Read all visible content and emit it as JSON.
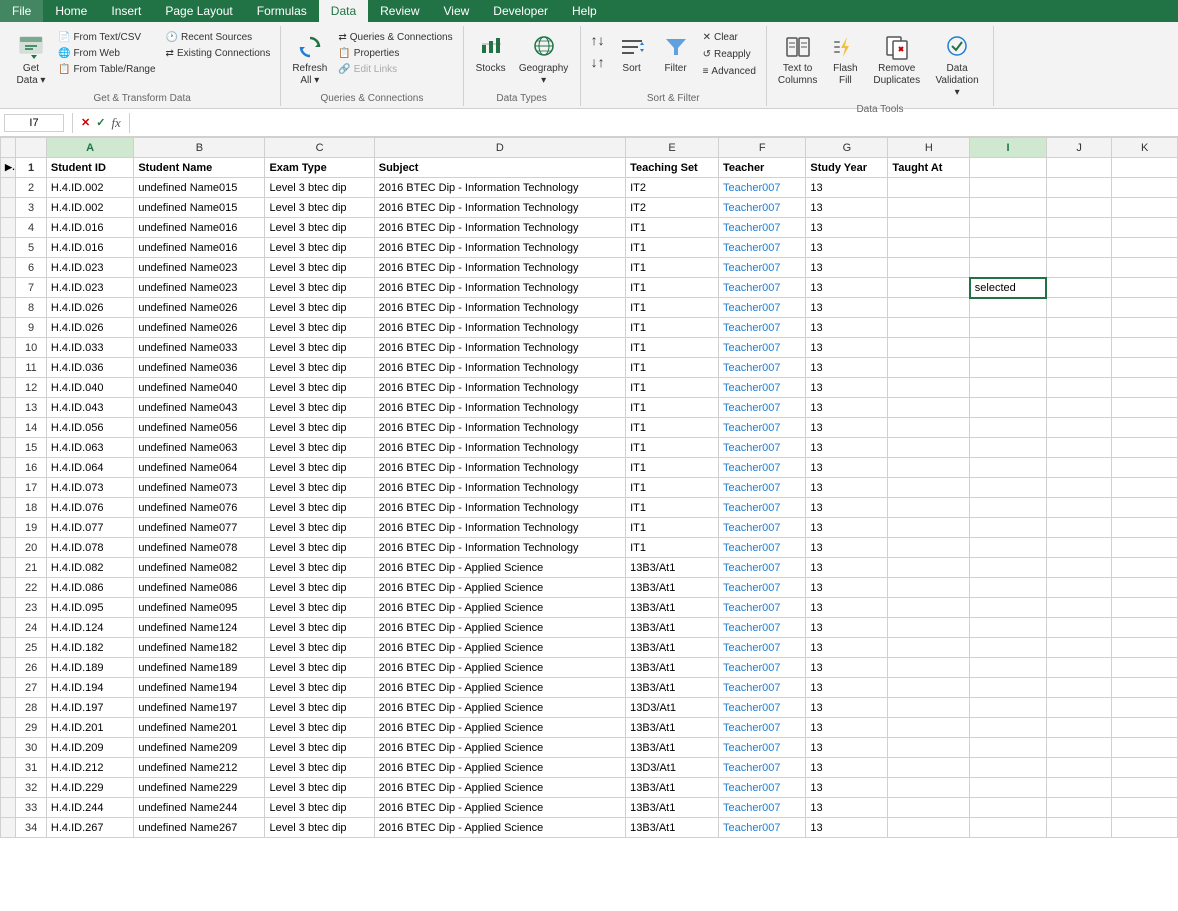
{
  "menubar": {
    "items": [
      "File",
      "Home",
      "Insert",
      "Page Layout",
      "Formulas",
      "Data",
      "Review",
      "View",
      "Developer",
      "Help"
    ]
  },
  "ribbon": {
    "active_tab": "Data",
    "groups": {
      "get_transform": {
        "label": "Get & Transform Data",
        "buttons": [
          {
            "id": "get-data",
            "icon": "📥",
            "label": "Get\nData",
            "dropdown": true
          },
          {
            "id": "from-text-csv",
            "icon": "📄",
            "label": "From\nText/CSV"
          },
          {
            "id": "from-web",
            "icon": "🌐",
            "label": "From\nWeb"
          },
          {
            "id": "from-table-range",
            "icon": "📋",
            "label": "From\nTable/\nRange"
          },
          {
            "id": "recent-sources",
            "icon": "🕐",
            "label": "Recent\nSources"
          },
          {
            "id": "existing-connections",
            "icon": "🔗",
            "label": "Existing\nConnections"
          }
        ]
      },
      "queries_connections": {
        "label": "Queries & Connections",
        "buttons_small": [
          {
            "id": "queries-connections",
            "icon": "⇄",
            "label": "Queries & Connections"
          },
          {
            "id": "properties",
            "icon": "📋",
            "label": "Properties"
          },
          {
            "id": "edit-links",
            "icon": "🔗",
            "label": "Edit Links"
          }
        ],
        "buttons_main": [
          {
            "id": "refresh-all",
            "icon": "🔄",
            "label": "Refresh\nAll",
            "dropdown": true
          }
        ]
      },
      "data_types": {
        "label": "Data Types",
        "buttons": [
          {
            "id": "stocks",
            "icon": "📈",
            "label": "Stocks"
          },
          {
            "id": "geography",
            "icon": "🌍",
            "label": "Geography",
            "dropdown": true
          }
        ]
      },
      "sort_filter": {
        "label": "Sort & Filter",
        "buttons": [
          {
            "id": "sort-asc",
            "icon": "↑",
            "label": ""
          },
          {
            "id": "sort-desc",
            "icon": "↓",
            "label": ""
          },
          {
            "id": "sort",
            "icon": "↕",
            "label": "Sort"
          },
          {
            "id": "filter",
            "icon": "▼",
            "label": "Filter"
          },
          {
            "id": "clear",
            "icon": "✕",
            "label": "Clear"
          },
          {
            "id": "reapply",
            "icon": "↺",
            "label": "Reapply"
          },
          {
            "id": "advanced",
            "icon": "≡",
            "label": "Advanced"
          }
        ]
      },
      "data_tools": {
        "label": "Data Tools",
        "buttons": [
          {
            "id": "text-to-columns",
            "icon": "⟺",
            "label": "Text to\nColumns"
          },
          {
            "id": "flash-fill",
            "icon": "⚡",
            "label": "Flash\nFill"
          },
          {
            "id": "remove-duplicates",
            "icon": "🗑",
            "label": "Remove\nDuplicates"
          },
          {
            "id": "data-validation",
            "icon": "✓",
            "label": "Data\nValidation",
            "dropdown": true
          }
        ]
      }
    }
  },
  "formula_bar": {
    "cell_ref": "I7",
    "formula": ""
  },
  "spreadsheet": {
    "columns": [
      "",
      "",
      "A",
      "B",
      "C",
      "D",
      "E",
      "F",
      "G",
      "H",
      "I",
      "J",
      "K"
    ],
    "col_letters": [
      "A",
      "B",
      "C",
      "D",
      "E",
      "F",
      "G",
      "H",
      "I",
      "J",
      "K"
    ],
    "headers": [
      "Student ID",
      "Student Name",
      "Exam Type",
      "Subject",
      "Teaching Set",
      "Teacher",
      "Study Year",
      "Taught At",
      "",
      "",
      ""
    ],
    "rows": [
      {
        "num": 2,
        "a": "H.4.ID.002",
        "b": "undefined Name015",
        "c": "Level 3 btec dip",
        "d": "2016 BTEC Dip - Information Technology",
        "e": "IT2",
        "f": "Teacher007",
        "g": "13",
        "h": "",
        "i": "",
        "j": "",
        "k": ""
      },
      {
        "num": 3,
        "a": "H.4.ID.002",
        "b": "undefined Name015",
        "c": "Level 3 btec dip",
        "d": "2016 BTEC Dip - Information Technology",
        "e": "IT2",
        "f": "Teacher007",
        "g": "13",
        "h": "",
        "i": "",
        "j": "",
        "k": ""
      },
      {
        "num": 4,
        "a": "H.4.ID.016",
        "b": "undefined Name016",
        "c": "Level 3 btec dip",
        "d": "2016 BTEC Dip - Information Technology",
        "e": "IT1",
        "f": "Teacher007",
        "g": "13",
        "h": "",
        "i": "",
        "j": "",
        "k": ""
      },
      {
        "num": 5,
        "a": "H.4.ID.016",
        "b": "undefined Name016",
        "c": "Level 3 btec dip",
        "d": "2016 BTEC Dip - Information Technology",
        "e": "IT1",
        "f": "Teacher007",
        "g": "13",
        "h": "",
        "i": "",
        "j": "",
        "k": ""
      },
      {
        "num": 6,
        "a": "H.4.ID.023",
        "b": "undefined Name023",
        "c": "Level 3 btec dip",
        "d": "2016 BTEC Dip - Information Technology",
        "e": "IT1",
        "f": "Teacher007",
        "g": "13",
        "h": "",
        "i": "",
        "j": "",
        "k": ""
      },
      {
        "num": 7,
        "a": "H.4.ID.023",
        "b": "undefined Name023",
        "c": "Level 3 btec dip",
        "d": "2016 BTEC Dip - Information Technology",
        "e": "IT1",
        "f": "Teacher007",
        "g": "13",
        "h": "",
        "i": "selected",
        "j": "",
        "k": ""
      },
      {
        "num": 8,
        "a": "H.4.ID.026",
        "b": "undefined Name026",
        "c": "Level 3 btec dip",
        "d": "2016 BTEC Dip - Information Technology",
        "e": "IT1",
        "f": "Teacher007",
        "g": "13",
        "h": "",
        "i": "",
        "j": "",
        "k": ""
      },
      {
        "num": 9,
        "a": "H.4.ID.026",
        "b": "undefined Name026",
        "c": "Level 3 btec dip",
        "d": "2016 BTEC Dip - Information Technology",
        "e": "IT1",
        "f": "Teacher007",
        "g": "13",
        "h": "",
        "i": "",
        "j": "",
        "k": ""
      },
      {
        "num": 10,
        "a": "H.4.ID.033",
        "b": "undefined Name033",
        "c": "Level 3 btec dip",
        "d": "2016 BTEC Dip - Information Technology",
        "e": "IT1",
        "f": "Teacher007",
        "g": "13",
        "h": "",
        "i": "",
        "j": "",
        "k": ""
      },
      {
        "num": 11,
        "a": "H.4.ID.036",
        "b": "undefined Name036",
        "c": "Level 3 btec dip",
        "d": "2016 BTEC Dip - Information Technology",
        "e": "IT1",
        "f": "Teacher007",
        "g": "13",
        "h": "",
        "i": "",
        "j": "",
        "k": ""
      },
      {
        "num": 12,
        "a": "H.4.ID.040",
        "b": "undefined Name040",
        "c": "Level 3 btec dip",
        "d": "2016 BTEC Dip - Information Technology",
        "e": "IT1",
        "f": "Teacher007",
        "g": "13",
        "h": "",
        "i": "",
        "j": "",
        "k": ""
      },
      {
        "num": 13,
        "a": "H.4.ID.043",
        "b": "undefined Name043",
        "c": "Level 3 btec dip",
        "d": "2016 BTEC Dip - Information Technology",
        "e": "IT1",
        "f": "Teacher007",
        "g": "13",
        "h": "",
        "i": "",
        "j": "",
        "k": ""
      },
      {
        "num": 14,
        "a": "H.4.ID.056",
        "b": "undefined Name056",
        "c": "Level 3 btec dip",
        "d": "2016 BTEC Dip - Information Technology",
        "e": "IT1",
        "f": "Teacher007",
        "g": "13",
        "h": "",
        "i": "",
        "j": "",
        "k": ""
      },
      {
        "num": 15,
        "a": "H.4.ID.063",
        "b": "undefined Name063",
        "c": "Level 3 btec dip",
        "d": "2016 BTEC Dip - Information Technology",
        "e": "IT1",
        "f": "Teacher007",
        "g": "13",
        "h": "",
        "i": "",
        "j": "",
        "k": ""
      },
      {
        "num": 16,
        "a": "H.4.ID.064",
        "b": "undefined Name064",
        "c": "Level 3 btec dip",
        "d": "2016 BTEC Dip - Information Technology",
        "e": "IT1",
        "f": "Teacher007",
        "g": "13",
        "h": "",
        "i": "",
        "j": "",
        "k": ""
      },
      {
        "num": 17,
        "a": "H.4.ID.073",
        "b": "undefined Name073",
        "c": "Level 3 btec dip",
        "d": "2016 BTEC Dip - Information Technology",
        "e": "IT1",
        "f": "Teacher007",
        "g": "13",
        "h": "",
        "i": "",
        "j": "",
        "k": ""
      },
      {
        "num": 18,
        "a": "H.4.ID.076",
        "b": "undefined Name076",
        "c": "Level 3 btec dip",
        "d": "2016 BTEC Dip - Information Technology",
        "e": "IT1",
        "f": "Teacher007",
        "g": "13",
        "h": "",
        "i": "",
        "j": "",
        "k": ""
      },
      {
        "num": 19,
        "a": "H.4.ID.077",
        "b": "undefined Name077",
        "c": "Level 3 btec dip",
        "d": "2016 BTEC Dip - Information Technology",
        "e": "IT1",
        "f": "Teacher007",
        "g": "13",
        "h": "",
        "i": "",
        "j": "",
        "k": ""
      },
      {
        "num": 20,
        "a": "H.4.ID.078",
        "b": "undefined Name078",
        "c": "Level 3 btec dip",
        "d": "2016 BTEC Dip - Information Technology",
        "e": "IT1",
        "f": "Teacher007",
        "g": "13",
        "h": "",
        "i": "",
        "j": "",
        "k": ""
      },
      {
        "num": 21,
        "a": "H.4.ID.082",
        "b": "undefined Name082",
        "c": "Level 3 btec dip",
        "d": "2016 BTEC Dip - Applied Science",
        "e": "13B3/At1",
        "f": "Teacher007",
        "g": "13",
        "h": "",
        "i": "",
        "j": "",
        "k": ""
      },
      {
        "num": 22,
        "a": "H.4.ID.086",
        "b": "undefined Name086",
        "c": "Level 3 btec dip",
        "d": "2016 BTEC Dip - Applied Science",
        "e": "13B3/At1",
        "f": "Teacher007",
        "g": "13",
        "h": "",
        "i": "",
        "j": "",
        "k": ""
      },
      {
        "num": 23,
        "a": "H.4.ID.095",
        "b": "undefined Name095",
        "c": "Level 3 btec dip",
        "d": "2016 BTEC Dip - Applied Science",
        "e": "13B3/At1",
        "f": "Teacher007",
        "g": "13",
        "h": "",
        "i": "",
        "j": "",
        "k": ""
      },
      {
        "num": 24,
        "a": "H.4.ID.124",
        "b": "undefined Name124",
        "c": "Level 3 btec dip",
        "d": "2016 BTEC Dip - Applied Science",
        "e": "13B3/At1",
        "f": "Teacher007",
        "g": "13",
        "h": "",
        "i": "",
        "j": "",
        "k": ""
      },
      {
        "num": 25,
        "a": "H.4.ID.182",
        "b": "undefined Name182",
        "c": "Level 3 btec dip",
        "d": "2016 BTEC Dip - Applied Science",
        "e": "13B3/At1",
        "f": "Teacher007",
        "g": "13",
        "h": "",
        "i": "",
        "j": "",
        "k": ""
      },
      {
        "num": 26,
        "a": "H.4.ID.189",
        "b": "undefined Name189",
        "c": "Level 3 btec dip",
        "d": "2016 BTEC Dip - Applied Science",
        "e": "13B3/At1",
        "f": "Teacher007",
        "g": "13",
        "h": "",
        "i": "",
        "j": "",
        "k": ""
      },
      {
        "num": 27,
        "a": "H.4.ID.194",
        "b": "undefined Name194",
        "c": "Level 3 btec dip",
        "d": "2016 BTEC Dip - Applied Science",
        "e": "13B3/At1",
        "f": "Teacher007",
        "g": "13",
        "h": "",
        "i": "",
        "j": "",
        "k": ""
      },
      {
        "num": 28,
        "a": "H.4.ID.197",
        "b": "undefined Name197",
        "c": "Level 3 btec dip",
        "d": "2016 BTEC Dip - Applied Science",
        "e": "13D3/At1",
        "f": "Teacher007",
        "g": "13",
        "h": "",
        "i": "",
        "j": "",
        "k": ""
      },
      {
        "num": 29,
        "a": "H.4.ID.201",
        "b": "undefined Name201",
        "c": "Level 3 btec dip",
        "d": "2016 BTEC Dip - Applied Science",
        "e": "13B3/At1",
        "f": "Teacher007",
        "g": "13",
        "h": "",
        "i": "",
        "j": "",
        "k": ""
      },
      {
        "num": 30,
        "a": "H.4.ID.209",
        "b": "undefined Name209",
        "c": "Level 3 btec dip",
        "d": "2016 BTEC Dip - Applied Science",
        "e": "13B3/At1",
        "f": "Teacher007",
        "g": "13",
        "h": "",
        "i": "",
        "j": "",
        "k": ""
      },
      {
        "num": 31,
        "a": "H.4.ID.212",
        "b": "undefined Name212",
        "c": "Level 3 btec dip",
        "d": "2016 BTEC Dip - Applied Science",
        "e": "13D3/At1",
        "f": "Teacher007",
        "g": "13",
        "h": "",
        "i": "",
        "j": "",
        "k": ""
      },
      {
        "num": 32,
        "a": "H.4.ID.229",
        "b": "undefined Name229",
        "c": "Level 3 btec dip",
        "d": "2016 BTEC Dip - Applied Science",
        "e": "13B3/At1",
        "f": "Teacher007",
        "g": "13",
        "h": "",
        "i": "",
        "j": "",
        "k": ""
      },
      {
        "num": 33,
        "a": "H.4.ID.244",
        "b": "undefined Name244",
        "c": "Level 3 btec dip",
        "d": "2016 BTEC Dip - Applied Science",
        "e": "13B3/At1",
        "f": "Teacher007",
        "g": "13",
        "h": "",
        "i": "",
        "j": "",
        "k": ""
      },
      {
        "num": 34,
        "a": "H.4.ID.267",
        "b": "undefined Name267",
        "c": "Level 3 btec dip",
        "d": "2016 BTEC Dip - Applied Science",
        "e": "13B3/At1",
        "f": "Teacher007",
        "g": "13",
        "h": "",
        "i": "",
        "j": "",
        "k": ""
      }
    ]
  }
}
